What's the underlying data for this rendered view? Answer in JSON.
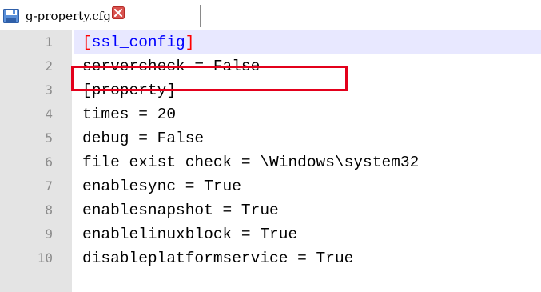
{
  "tab": {
    "filename": "g-property.cfg",
    "save_icon": "save-disk-icon",
    "close_icon": "close-icon"
  },
  "colors": {
    "gutter": "#e4e4e4",
    "current_line": "#e8e8ff",
    "section_bracket": "#ff0000",
    "section_name": "#0000ff",
    "highlight_box": "#e3001b",
    "line_number": "#8c8c8c"
  },
  "editor": {
    "lines": [
      {
        "number": "1",
        "open": "[",
        "section": "ssl_config",
        "close": "]"
      },
      {
        "number": "2",
        "text": "servercheck = False"
      },
      {
        "number": "3",
        "text": "[property]"
      },
      {
        "number": "4",
        "text": "times = 20"
      },
      {
        "number": "5",
        "text": "debug = False"
      },
      {
        "number": "6",
        "text": "file exist check = \\Windows\\system32"
      },
      {
        "number": "7",
        "text": "enablesync = True"
      },
      {
        "number": "8",
        "text": "enablesnapshot = True"
      },
      {
        "number": "9",
        "text": "enablelinuxblock = True"
      },
      {
        "number": "10",
        "text": "disableplatformservice = True"
      }
    ]
  }
}
